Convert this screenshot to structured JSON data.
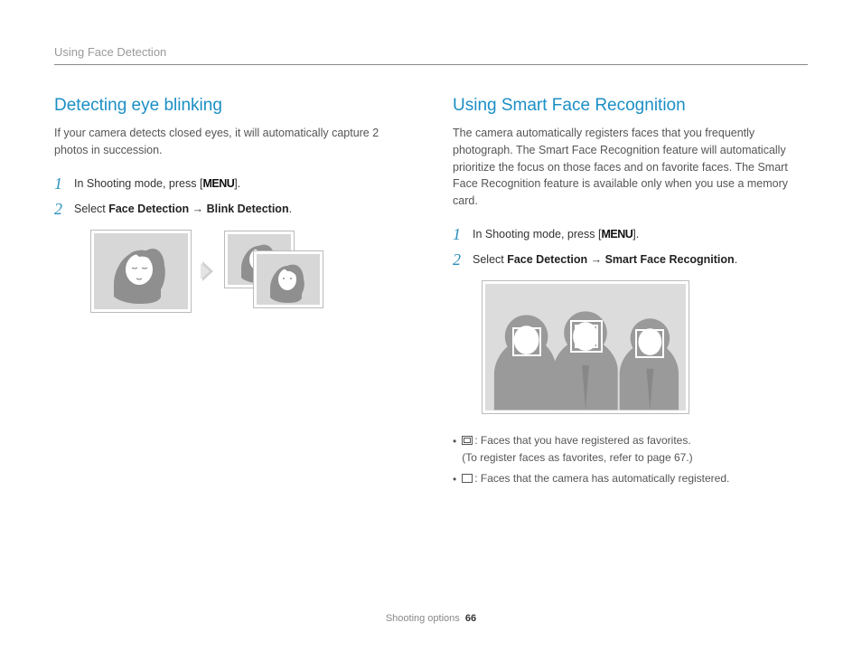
{
  "breadcrumb": "Using Face Detection",
  "left": {
    "title": "Detecting eye blinking",
    "intro": "If your camera detects closed eyes, it will automatically capture 2 photos in succession.",
    "step1_pre": "In Shooting mode, press [",
    "menu": "MENU",
    "step1_post": "].",
    "step2_pre": "Select ",
    "step2_b1": "Face Detection",
    "arrow": " → ",
    "step2_b2": "Blink Detection",
    "step2_post": "."
  },
  "right": {
    "title": "Using Smart Face Recognition",
    "intro": "The camera automatically registers faces that you frequently photograph. The Smart Face Recognition feature will automatically prioritize the focus on those faces and on favorite faces. The Smart Face Recognition feature is available only when you use a memory card.",
    "step1_pre": "In Shooting mode, press [",
    "menu": "MENU",
    "step1_post": "].",
    "step2_pre": "Select ",
    "step2_b1": "Face Detection",
    "arrow": " → ",
    "step2_b2": "Smart Face Recognition",
    "step2_post": ".",
    "bullet1a": ": Faces that you have registered as favorites.",
    "bullet1b": "(To register faces as favorites, refer to page 67.)",
    "bullet2": ": Faces that the camera has automatically registered."
  },
  "footer_label": "Shooting options",
  "page_number": "66"
}
